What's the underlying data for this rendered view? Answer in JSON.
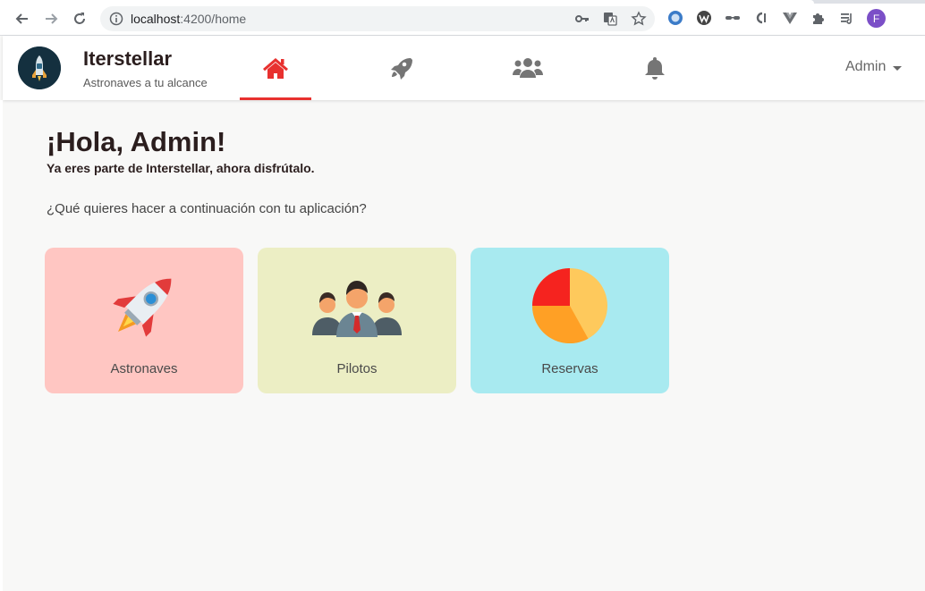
{
  "browser": {
    "url_host": "localhost",
    "url_path": ":4200/home",
    "profile_initial": "F"
  },
  "header": {
    "brand_title": "Iterstellar",
    "brand_subtitle": "Astronaves a tu alcance",
    "user_label": "Admin"
  },
  "content": {
    "greeting": "¡Hola, Admin!",
    "subgreeting": "Ya eres parte de Interstellar, ahora disfrútalo.",
    "question": "¿Qué quieres hacer a continuación con tu aplicación?",
    "cards": [
      {
        "label": "Astronaves",
        "color": "#ffc6c2"
      },
      {
        "label": "Pilotos",
        "color": "#eceec4"
      },
      {
        "label": "Reservas",
        "color": "#a8eaf0"
      }
    ]
  },
  "colors": {
    "accent": "#e8312f",
    "text_dark": "#2b1e1e"
  }
}
